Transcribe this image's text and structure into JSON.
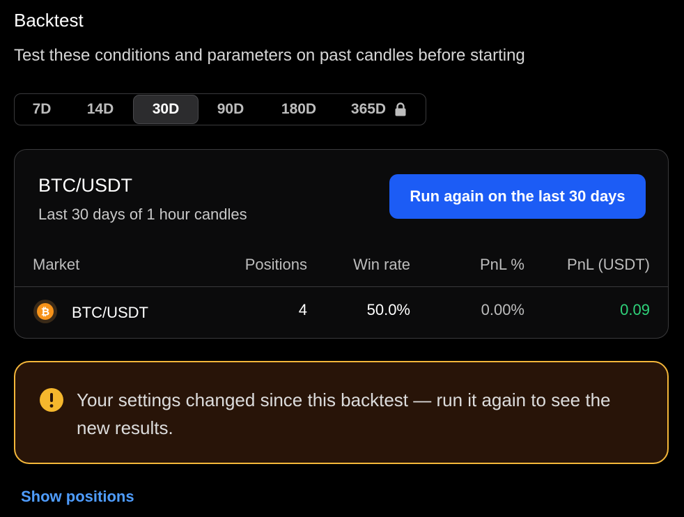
{
  "backtest": {
    "title": "Backtest",
    "subtitle": "Test these conditions and parameters on past candles before starting"
  },
  "periods": [
    {
      "label": "7D",
      "active": false,
      "locked": false
    },
    {
      "label": "14D",
      "active": false,
      "locked": false
    },
    {
      "label": "30D",
      "active": true,
      "locked": false
    },
    {
      "label": "90D",
      "active": false,
      "locked": false
    },
    {
      "label": "180D",
      "active": false,
      "locked": false
    },
    {
      "label": "365D",
      "active": false,
      "locked": true
    }
  ],
  "result": {
    "pair": "BTC/USDT",
    "description": "Last 30 days of 1 hour candles",
    "run_again_label": "Run again on the last 30 days",
    "columns": {
      "market": "Market",
      "positions": "Positions",
      "win_rate": "Win rate",
      "pnl_pct": "PnL %",
      "pnl_usdt": "PnL (USDT)"
    },
    "rows": [
      {
        "icon": "bitcoin-icon",
        "market": "BTC/USDT",
        "positions": "4",
        "win_rate": "50.0%",
        "pnl_pct": "0.00%",
        "pnl_usdt": "0.09"
      }
    ]
  },
  "warning": {
    "icon": "exclamation-icon",
    "text": "Your settings changed since this backtest — run it again to see the new results."
  },
  "show_positions_label": "Show positions",
  "colors": {
    "accent": "#1c5cf5",
    "link": "#4f9dff",
    "positive": "#2fd27a",
    "warning_border": "#f4b73a",
    "warning_bg": "#281408",
    "bitcoin": "#f7931a"
  }
}
